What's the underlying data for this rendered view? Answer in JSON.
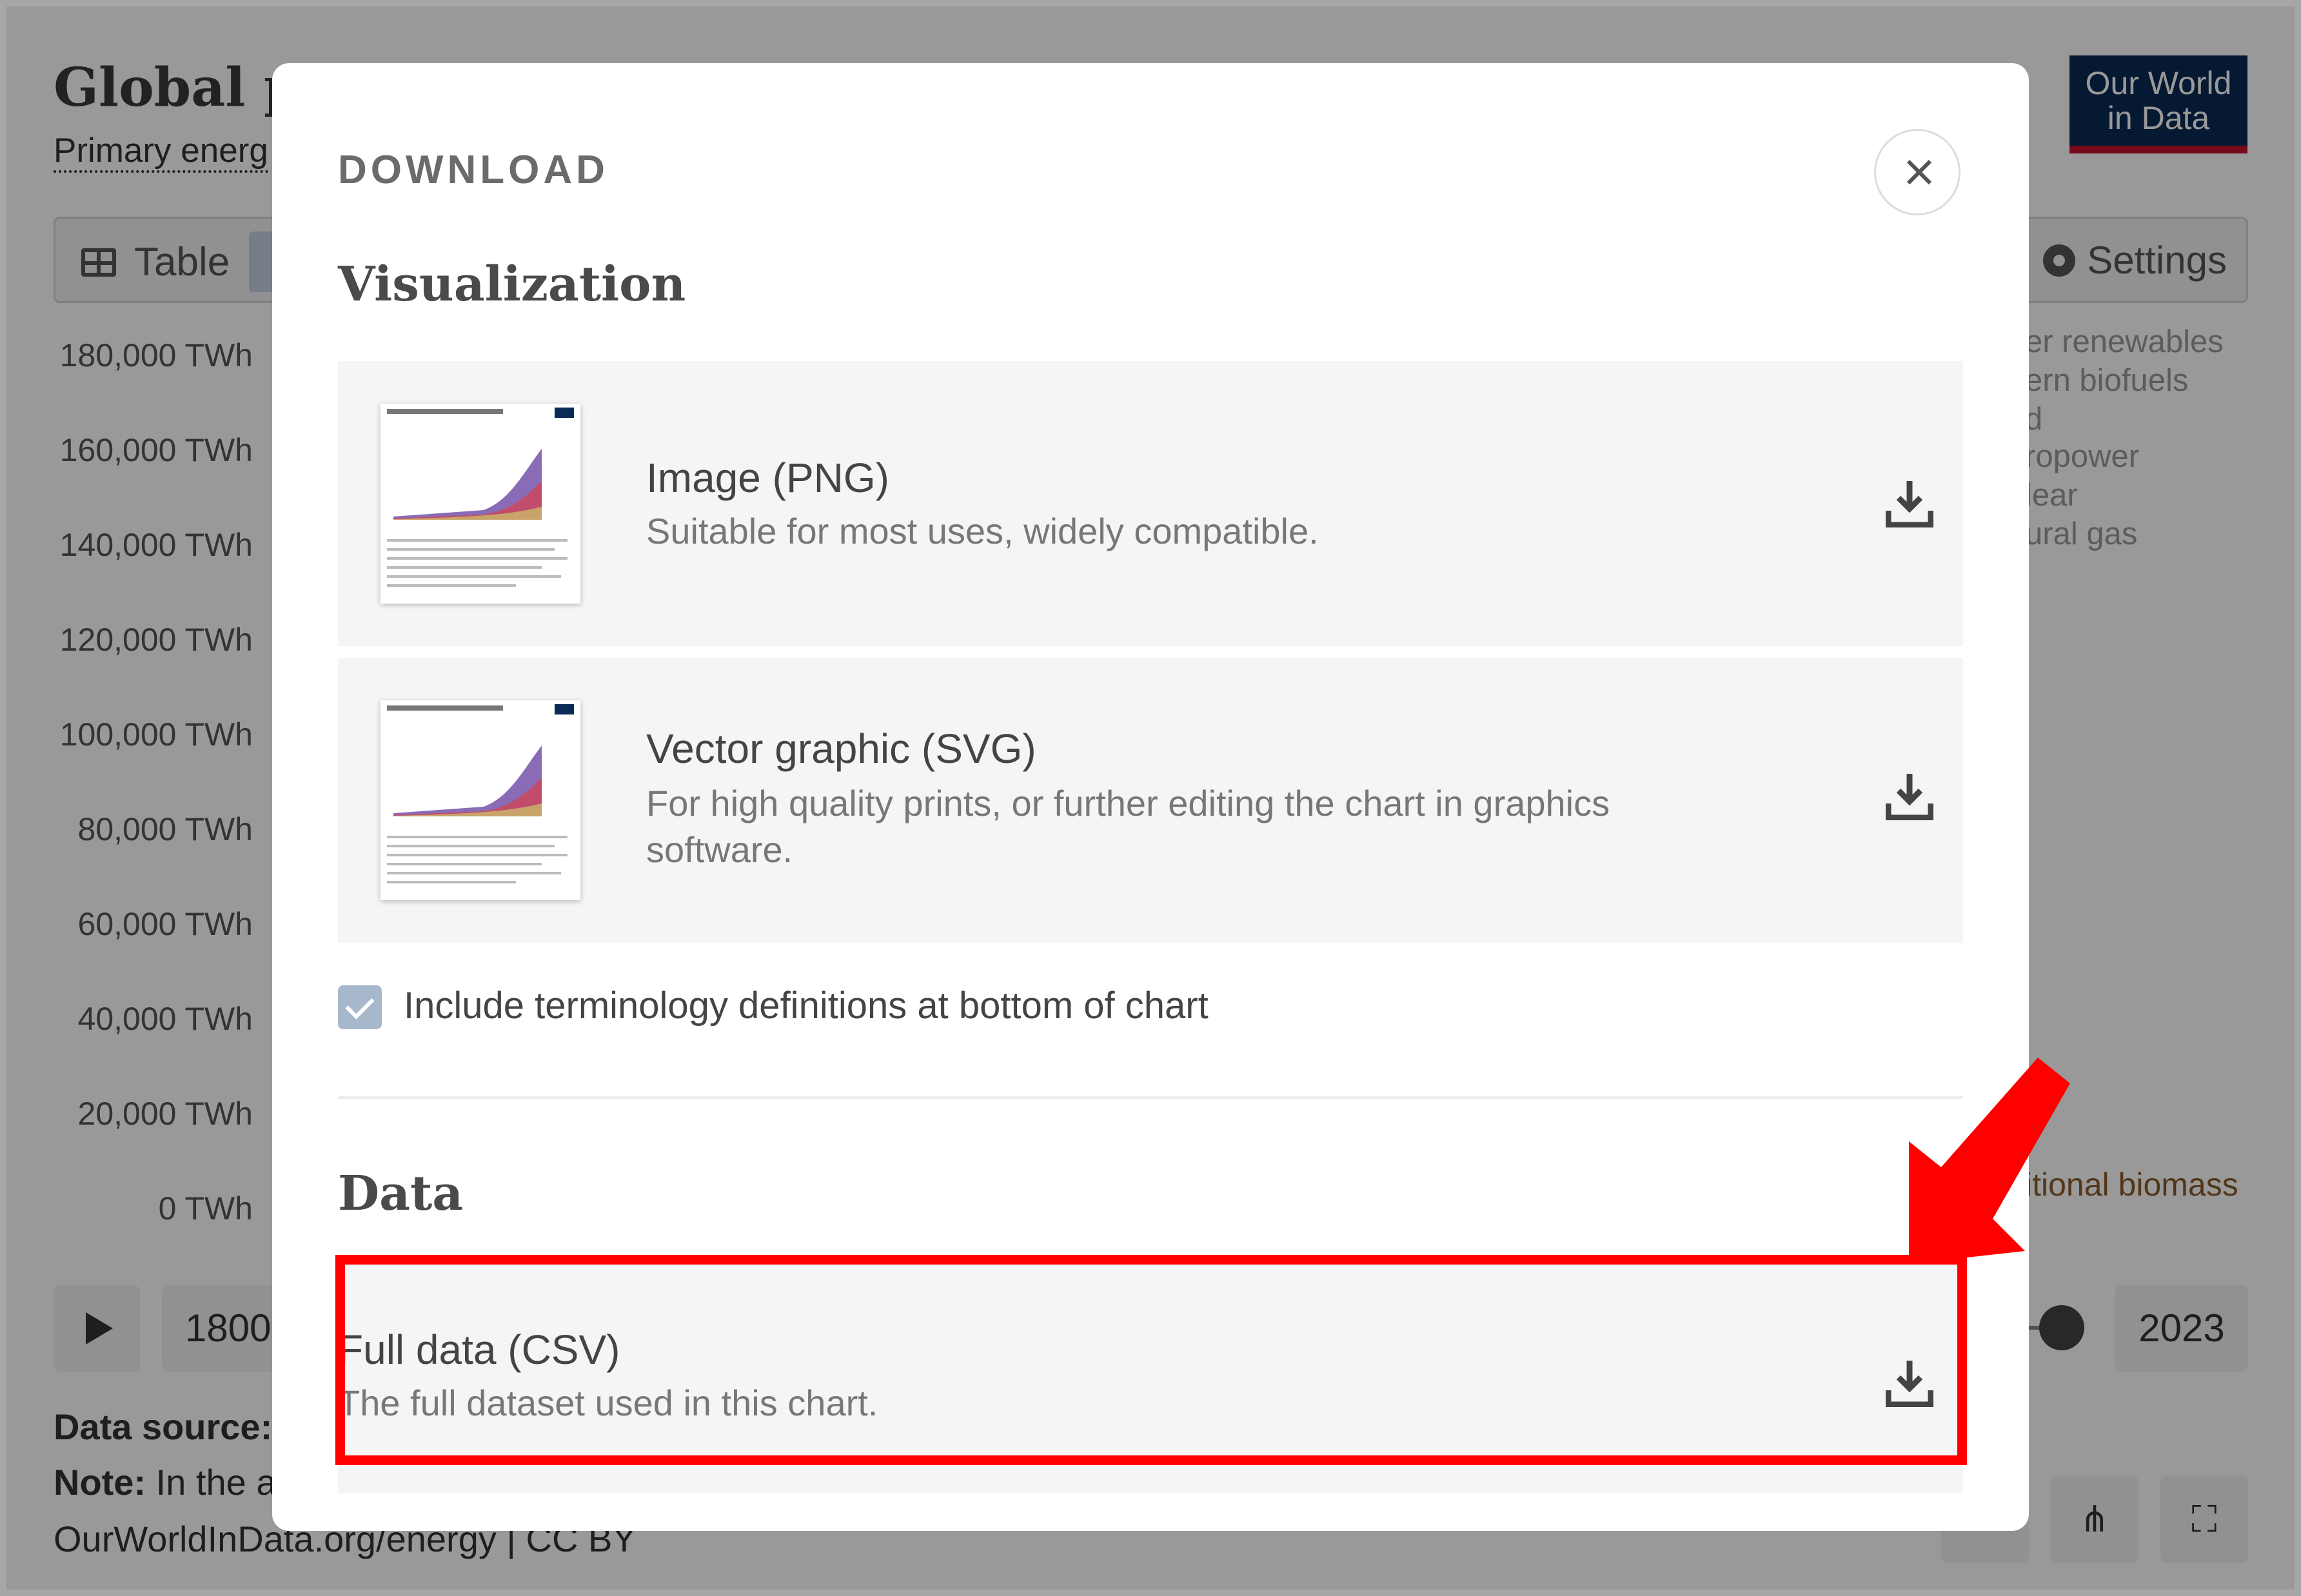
{
  "background": {
    "title": "Global pr",
    "subtitle": "Primary energ",
    "logo_line1": "Our World",
    "logo_line2": "in Data",
    "tab_table": "Table",
    "tab_settings": "Settings",
    "y_axis_ticks": [
      "180,000 TWh",
      "160,000 TWh",
      "140,000 TWh",
      "120,000 TWh",
      "100,000 TWh",
      "80,000 TWh",
      "60,000 TWh",
      "40,000 TWh",
      "20,000 TWh",
      "0 TWh"
    ],
    "legend_partial": [
      "er renewables",
      "ern biofuels",
      "d",
      "ropower",
      "lear",
      "ural gas"
    ],
    "legend_biomass": "itional biomass",
    "year_start": "1800",
    "year_end": "2023",
    "data_source_label": "Data source:",
    "note_label": "Note:",
    "note_text": "In the a",
    "footer_url": "OurWorldInData.org/energy | CC BY"
  },
  "modal": {
    "title": "DOWNLOAD",
    "visualization_heading": "Visualization",
    "png": {
      "title": "Image (PNG)",
      "description": "Suitable for most uses, widely compatible."
    },
    "svg": {
      "title": "Vector graphic (SVG)",
      "description": "For high quality prints, or further editing the chart in graphics software."
    },
    "checkbox_label": "Include terminology definitions at bottom of chart",
    "checkbox_checked": true,
    "data_heading": "Data",
    "csv": {
      "title": "Full data (CSV)",
      "description": "The full dataset used in this chart."
    }
  },
  "colors": {
    "highlight": "#ff0000",
    "logo_bg": "#0a2b56",
    "logo_accent": "#c8102e"
  },
  "icons": {
    "close": "close-icon",
    "download": "download-icon",
    "settings": "gear-icon",
    "table": "table-icon",
    "play": "play-icon",
    "share": "share-icon",
    "fullscreen": "fullscreen-icon"
  }
}
